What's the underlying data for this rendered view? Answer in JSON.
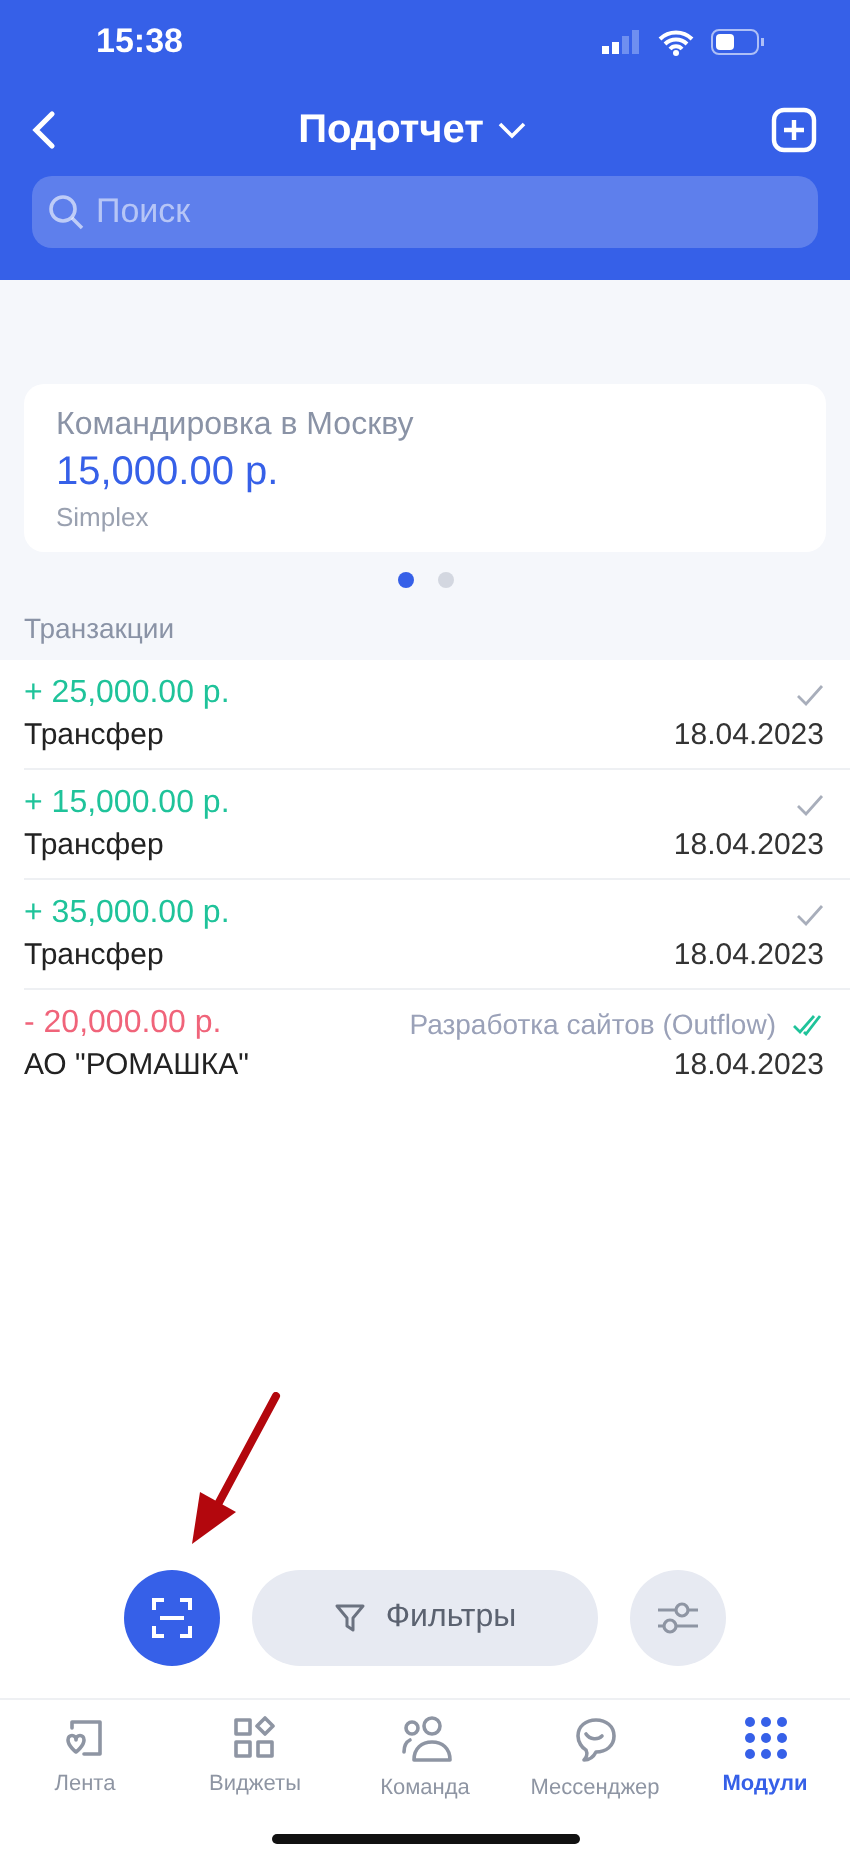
{
  "status_bar": {
    "time": "15:38"
  },
  "header": {
    "title": "Подотчет"
  },
  "search": {
    "placeholder": "Поиск"
  },
  "card": {
    "title": "Командировка в Москву",
    "amount": "15,000.00 р.",
    "subtitle": "Simplex"
  },
  "pager": [
    {
      "selected": true
    },
    {
      "selected": false
    }
  ],
  "section_title": "Транзакции",
  "transactions": [
    {
      "amount": "+ 25,000.00 р.",
      "kind": "income",
      "name": "Трансфер",
      "date": "18.04.2023",
      "confirmed": false
    },
    {
      "amount": "+ 15,000.00 р.",
      "kind": "income",
      "name": "Трансфер",
      "date": "18.04.2023",
      "confirmed": false
    },
    {
      "amount": "+ 35,000.00 р.",
      "kind": "income",
      "name": "Трансфер",
      "date": "18.04.2023",
      "confirmed": false
    },
    {
      "amount": "- 20,000.00 р.",
      "kind": "outcome",
      "name": "АО \"РОМАШКА\"",
      "category": "Разработка сайтов (Outflow)",
      "date": "18.04.2023",
      "confirmed": true
    }
  ],
  "actions": {
    "filter_label": "Фильтры"
  },
  "tabs": [
    {
      "label": "Лента",
      "selected": false
    },
    {
      "label": "Виджеты",
      "selected": false
    },
    {
      "label": "Команда",
      "selected": false
    },
    {
      "label": "Мессенджер",
      "selected": false
    },
    {
      "label": "Модули",
      "selected": true
    }
  ]
}
